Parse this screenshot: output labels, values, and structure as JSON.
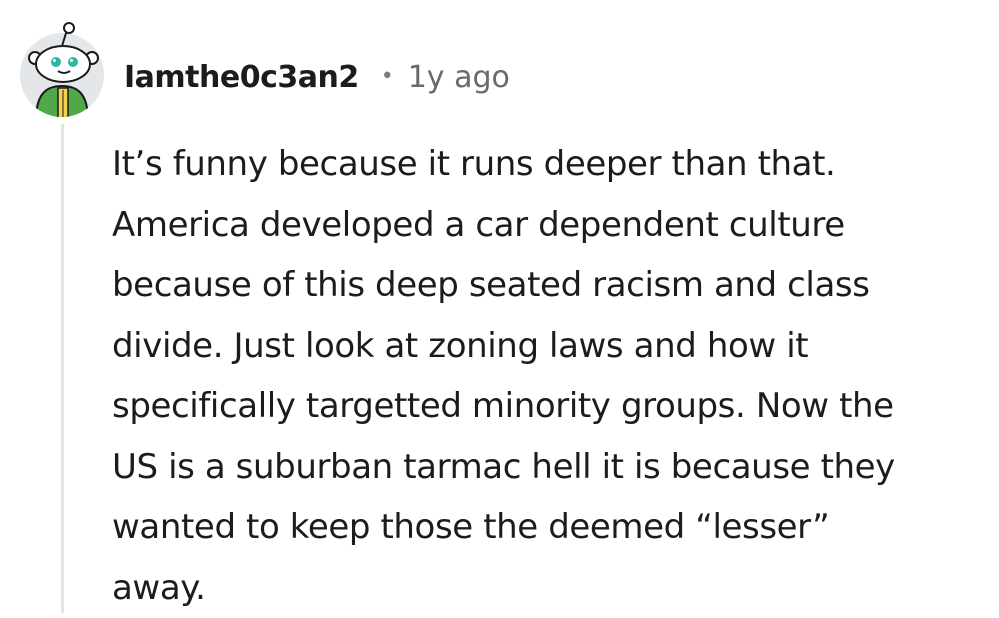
{
  "comment": {
    "username": "Iamthe0c3an2",
    "separator": "•",
    "timestamp": "1y ago",
    "avatar_icon": "reddit-snoo-avatar-icon",
    "body_lines": [
      "It’s funny because it runs deeper than that.",
      "America developed a car dependent culture",
      "because of this deep seated racism and class",
      "divide. Just look at zoning laws and how it",
      "specifically targetted minority groups. Now the",
      "US is a suburban tarmac hell it is because they",
      "wanted to keep those the deemed “lesser”",
      "away."
    ]
  },
  "colors": {
    "thread_line": "#e3e6e8",
    "avatar_background": "#e4e7e9",
    "avatar_body": "#4fa84a",
    "text": "#1c1c1c",
    "meta_text": "#6a6a6a"
  }
}
